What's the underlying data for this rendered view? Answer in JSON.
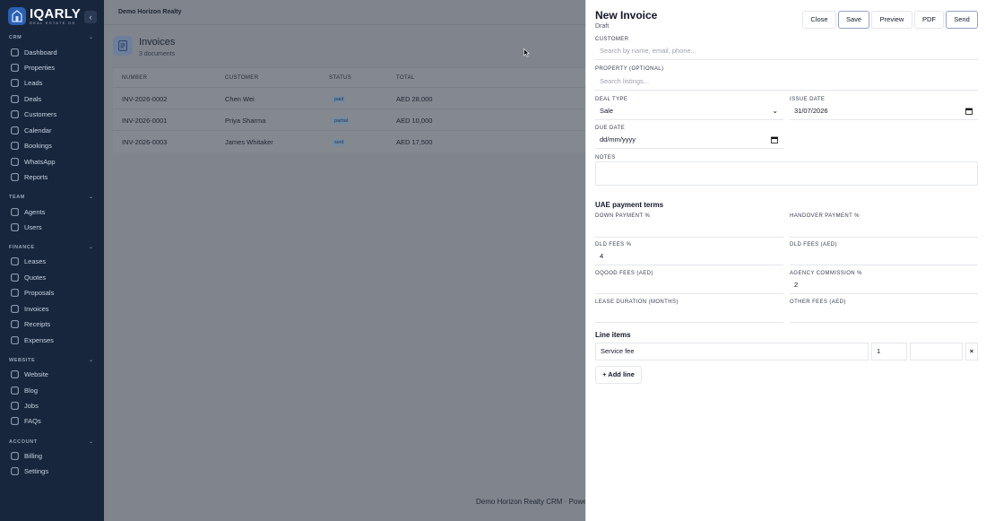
{
  "brand": {
    "name": "IQARLY",
    "tagline": "REAL ESTATE OS"
  },
  "sidebar": {
    "sections": [
      {
        "title": "CRM",
        "items": [
          "Dashboard",
          "Properties",
          "Leads",
          "Deals",
          "Customers",
          "Calendar",
          "Bookings",
          "WhatsApp",
          "Reports"
        ]
      },
      {
        "title": "TEAM",
        "items": [
          "Agents",
          "Users"
        ]
      },
      {
        "title": "FINANCE",
        "items": [
          "Leases",
          "Quotes",
          "Proposals",
          "Invoices",
          "Receipts",
          "Expenses"
        ]
      },
      {
        "title": "WEBSITE",
        "items": [
          "Website",
          "Blog",
          "Jobs",
          "FAQs"
        ]
      },
      {
        "title": "ACCOUNT",
        "items": [
          "Billing",
          "Settings"
        ]
      }
    ],
    "collapse_icon": "chevron-left-icon"
  },
  "topbar": {
    "org_name": "Demo Horizon Realty"
  },
  "page": {
    "title": "Invoices",
    "subtitle": "3 documents"
  },
  "table": {
    "headers": [
      "NUMBER",
      "CUSTOMER",
      "STATUS",
      "TOTAL"
    ],
    "rows": [
      {
        "number": "INV-2026-0002",
        "customer": "Chen Wei",
        "status": "paid",
        "total": "AED 28,000"
      },
      {
        "number": "INV-2026-0001",
        "customer": "Priya Sharma",
        "status": "partial",
        "total": "AED 10,000"
      },
      {
        "number": "INV-2026-0003",
        "customer": "James Whitaker",
        "status": "sent",
        "total": "AED 17,500"
      }
    ]
  },
  "footer": {
    "text": "Demo Horizon Realty CRM · Powered"
  },
  "drawer": {
    "title": "New Invoice",
    "status": "Draft",
    "buttons": {
      "close": "Close",
      "save": "Save",
      "preview": "Preview",
      "pdf": "PDF",
      "send": "Send"
    },
    "customer": {
      "label": "CUSTOMER",
      "placeholder": "Search by name, email, phone..."
    },
    "property": {
      "label": "PROPERTY (OPTIONAL)",
      "placeholder": "Search listings..."
    },
    "deal_type": {
      "label": "DEAL TYPE",
      "value": "Sale"
    },
    "issue_date": {
      "label": "ISSUE DATE",
      "value": "31/07/2026"
    },
    "due_date": {
      "label": "DUE DATE",
      "value": "dd/mm/yyyy"
    },
    "notes": {
      "label": "NOTES"
    },
    "uae_terms": {
      "heading": "UAE payment terms",
      "down_payment": {
        "label": "DOWN PAYMENT %",
        "value": ""
      },
      "handover_payment": {
        "label": "HANDOVER PAYMENT %",
        "value": ""
      },
      "dld_fees_pct": {
        "label": "DLD FEES %",
        "value": "4"
      },
      "dld_fees_aed": {
        "label": "DLD FEES (AED)",
        "value": ""
      },
      "oqood_fees": {
        "label": "OQOOD FEES (AED)",
        "value": ""
      },
      "agency_commission": {
        "label": "AGENCY COMMISSION %",
        "value": "2"
      },
      "lease_duration": {
        "label": "LEASE DURATION (MONTHS)",
        "value": ""
      },
      "other_fees": {
        "label": "OTHER FEES (AED)",
        "value": ""
      }
    },
    "line_items": {
      "heading": "Line items",
      "items": [
        {
          "description": "Service fee",
          "qty": "1",
          "price": ""
        }
      ],
      "remove_symbol": "×",
      "add_label": "+ Add line"
    }
  }
}
